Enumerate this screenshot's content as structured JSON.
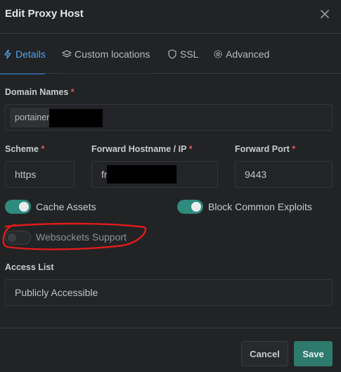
{
  "modal": {
    "title": "Edit Proxy Host"
  },
  "tabs": [
    {
      "label": "Details",
      "icon": "lightning-icon",
      "active": true
    },
    {
      "label": "Custom locations",
      "icon": "layers-icon",
      "active": false
    },
    {
      "label": "SSL",
      "icon": "shield-icon",
      "active": false
    },
    {
      "label": "Advanced",
      "icon": "gear-icon",
      "active": false
    }
  ],
  "domain_names": {
    "label": "Domain Names",
    "required_mark": "*",
    "chip": "portainer"
  },
  "scheme": {
    "label": "Scheme",
    "required_mark": "*",
    "value": "https"
  },
  "forward_hostname": {
    "label": "Forward Hostname / IP",
    "required_mark": "*",
    "value": "fr"
  },
  "forward_port": {
    "label": "Forward Port",
    "required_mark": "*",
    "value": "9443"
  },
  "toggles": {
    "cache_assets": {
      "label": "Cache Assets",
      "on": true
    },
    "block_exploits": {
      "label": "Block Common Exploits",
      "on": true
    },
    "websockets": {
      "label": "Websockets Support",
      "on": false
    }
  },
  "access_list": {
    "label": "Access List",
    "value": "Publicly Accessible"
  },
  "footer": {
    "cancel_label": "Cancel",
    "save_label": "Save"
  },
  "colors": {
    "accent": "#4ea3f2",
    "toggle_on": "#2e8b7d",
    "save": "#2e7a6c",
    "required": "#e05a5a",
    "annotation": "#e01b1b"
  }
}
